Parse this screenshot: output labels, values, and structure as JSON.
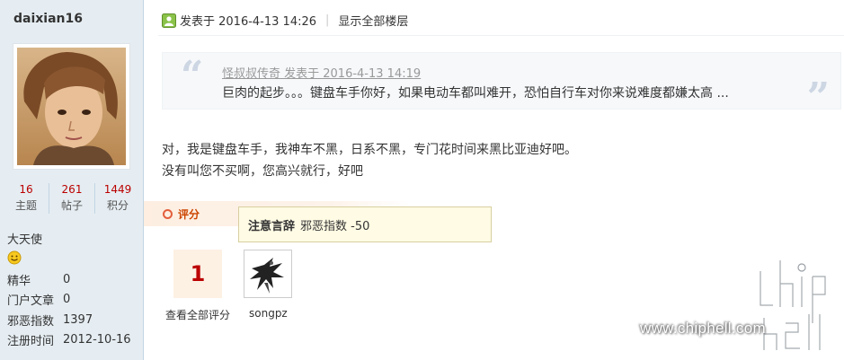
{
  "author": {
    "username": "daixian16",
    "stats": [
      {
        "value": "16",
        "label": "主题"
      },
      {
        "value": "261",
        "label": "帖子"
      },
      {
        "value": "1449",
        "label": "积分"
      }
    ],
    "rank": "大天使",
    "profile": [
      {
        "key": "精华",
        "value": "0"
      },
      {
        "key": "门户文章",
        "value": "0"
      },
      {
        "key": "邪恶指数",
        "value": "1397"
      },
      {
        "key": "注册时间",
        "value": "2012-10-16"
      }
    ]
  },
  "post": {
    "posted_at": "发表于 2016-4-13 14:26",
    "show_all_floors": "显示全部楼层",
    "quote": {
      "meta": "怪叔叔传奇 发表于 2016-4-13 14:19",
      "text": "巨肉的起步。。。键盘车手你好，如果电动车都叫难开，恐怕自行车对你来说难度都嫌太高 ...",
      "open_mark": "“",
      "close_mark": "”"
    },
    "lines": [
      "对，我是键盘车手，我神车不黑，日系不黑，专门花时间来黑比亚迪好吧。",
      "没有叫您不买啊，您高兴就行，好吧"
    ]
  },
  "rating": {
    "label": "评分",
    "count": "1",
    "view_all": "查看全部评分",
    "rater": "songpz",
    "tooltip_title": "注意言辞",
    "tooltip_value": "邪恶指数 -50"
  },
  "watermark": {
    "logo_text": "chip hell",
    "url": "www.chiphell.com"
  },
  "colors": {
    "sidebar_bg": "#e5edf2",
    "accent_red": "#bb0000",
    "rating_orange": "#e35f3c"
  }
}
